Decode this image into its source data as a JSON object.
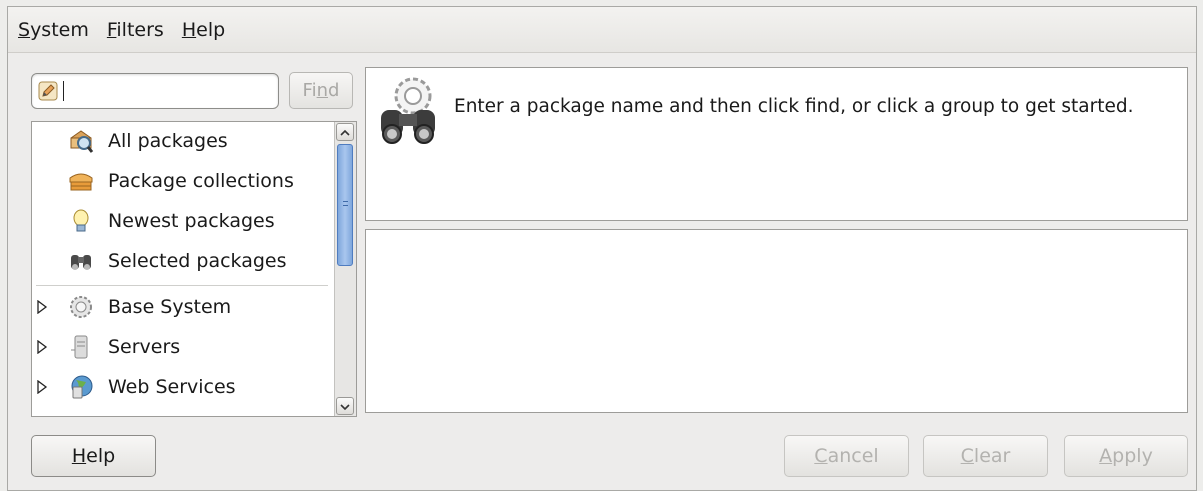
{
  "menubar": {
    "items": [
      {
        "mnemonic": "S",
        "rest": "ystem"
      },
      {
        "mnemonic": "F",
        "rest": "ilters"
      },
      {
        "mnemonic": "H",
        "rest": "elp"
      }
    ]
  },
  "search": {
    "value": "",
    "find_label_pre": "Fi",
    "find_label_mn": "n",
    "find_label_post": "d"
  },
  "groups": {
    "items": [
      {
        "label": "All packages",
        "icon": "all-packages-icon"
      },
      {
        "label": "Package collections",
        "icon": "package-box-icon"
      },
      {
        "label": "Newest packages",
        "icon": "lightbulb-icon"
      },
      {
        "label": "Selected packages",
        "icon": "binoculars-icon"
      },
      {
        "label": "Base System",
        "icon": "gear-icon"
      },
      {
        "label": "Servers",
        "icon": "server-icon"
      },
      {
        "label": "Web Services",
        "icon": "globe-server-icon"
      }
    ]
  },
  "info": {
    "message": "Enter a package name and then click find, or click a group to get started."
  },
  "buttons": {
    "help": {
      "mn": "H",
      "rest": "elp"
    },
    "cancel": {
      "mn": "C",
      "rest": "ancel"
    },
    "clear": {
      "mn": "C",
      "rest": "lear"
    },
    "apply": {
      "mn": "A",
      "rest": "pply"
    }
  },
  "colors": {
    "scroll_thumb": "#7fa7dc",
    "window_bg": "#edeceb"
  }
}
